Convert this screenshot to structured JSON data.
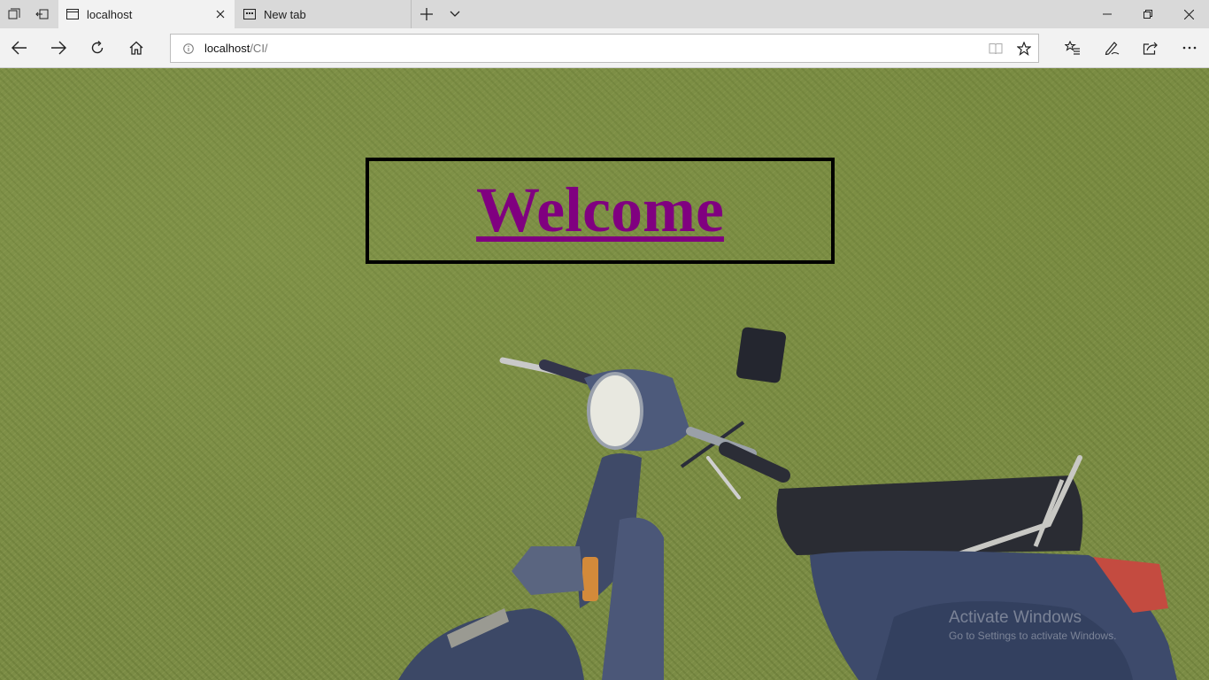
{
  "tabs": [
    {
      "label": "localhost",
      "icon": "page-icon",
      "active": true
    },
    {
      "label": "New tab",
      "icon": "new-tab-page-icon",
      "active": false
    }
  ],
  "address": {
    "host": "localhost",
    "path": "/CI/"
  },
  "page": {
    "heading": "Welcome",
    "heading_color": "#800080"
  },
  "watermark": {
    "line1": "Activate Windows",
    "line2": "Go to Settings to activate Windows."
  },
  "colors": {
    "tabstrip_bg": "#d9d9d9",
    "active_tab_bg": "#f2f2f2",
    "background_image": "green hedge with blue scooter"
  }
}
